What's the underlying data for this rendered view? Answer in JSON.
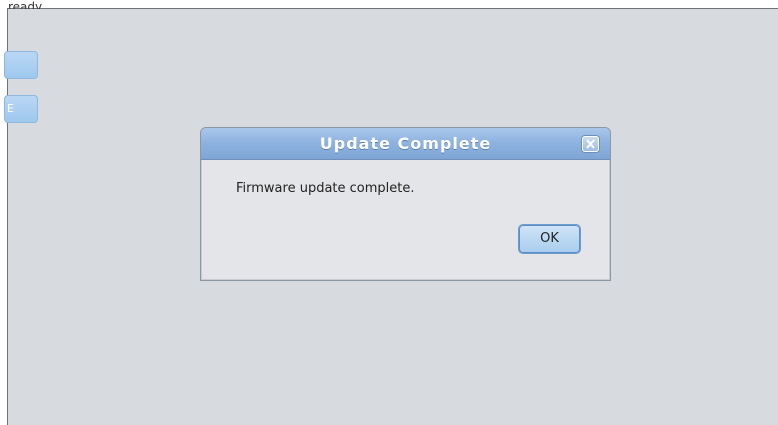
{
  "page": {
    "top_text": "ready."
  },
  "side_buttons": [
    {
      "label": ""
    },
    {
      "label": "E"
    }
  ],
  "dialog": {
    "title": "Update Complete",
    "message": "Firmware update complete.",
    "ok_label": "OK",
    "close_icon": "close-icon"
  },
  "colors": {
    "background": "#d7dade",
    "titlebar": "#8fb3e0",
    "button": "#b9d7f4"
  }
}
